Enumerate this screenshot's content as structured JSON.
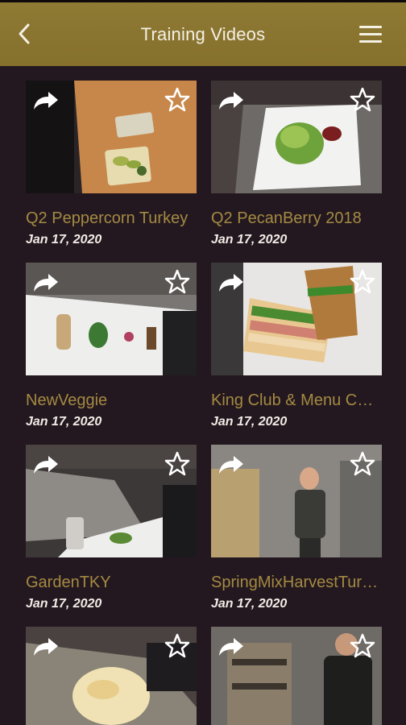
{
  "header": {
    "title": "Training Videos",
    "back_icon": "chevron-left-icon",
    "menu_icon": "hamburger-menu-icon",
    "bar_color": "#8c772f"
  },
  "videos": [
    {
      "title": "Q2 Peppercorn Turkey",
      "date": "Jan 17, 2020"
    },
    {
      "title": "Q2 PecanBerry 2018",
      "date": "Jan 17, 2020"
    },
    {
      "title": "NewVeggie",
      "date": "Jan 17, 2020"
    },
    {
      "title": "King Club & Menu Combo",
      "date": "Jan 17, 2020"
    },
    {
      "title": "GardenTKY",
      "date": "Jan 17, 2020"
    },
    {
      "title": "SpringMixHarvestTurkey",
      "date": "Jan 17, 2020"
    },
    {
      "title": "",
      "date": ""
    },
    {
      "title": "",
      "date": ""
    }
  ],
  "colors": {
    "background": "#241820",
    "title_text": "#a48a42",
    "date_text": "#f0ece6"
  }
}
